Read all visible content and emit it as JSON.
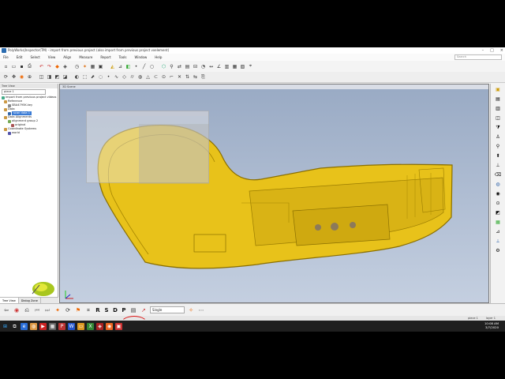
{
  "window": {
    "title": "PolyWorks|Inspector(TM) - import from previous project (also import from previous project vxelement)"
  },
  "menu": {
    "items": [
      "File",
      "Edit",
      "Select",
      "View",
      "Align",
      "Measure",
      "Report",
      "Tools",
      "Window",
      "Help"
    ],
    "search_placeholder": "Search"
  },
  "tree_panel": {
    "header": "Tree View",
    "selector_value": "piece 1",
    "items": [
      {
        "label": "import from previous project videos"
      },
      {
        "label": "Reference"
      },
      {
        "label": "SBA4795K.key"
      },
      {
        "label": "Data"
      },
      {
        "label": "scan data 1"
      },
      {
        "label": "Data Alignments"
      },
      {
        "label": "alignment group 2"
      },
      {
        "label": "original"
      },
      {
        "label": "Coordinate Systems"
      },
      {
        "label": "world"
      }
    ],
    "tabs": [
      "Tree View",
      "Dialog Zone"
    ]
  },
  "viewport": {
    "header": "3D Scene",
    "part_color": "#e8c21a"
  },
  "bottom_toolbar": {
    "letters": [
      "R",
      "S",
      "D",
      "P"
    ],
    "select_value": "Single"
  },
  "statusbar": {
    "left": "piece 1",
    "right": "layer 1"
  },
  "taskbar": {
    "time": "10:08 AM",
    "date": "3/7/2020"
  },
  "colors": {
    "viewport_top": "#99aac4",
    "viewport_bottom": "#c4cfe0",
    "part": "#e8c21a",
    "part_edge": "#8a6f00",
    "taskbar": "#1f1f1f"
  }
}
